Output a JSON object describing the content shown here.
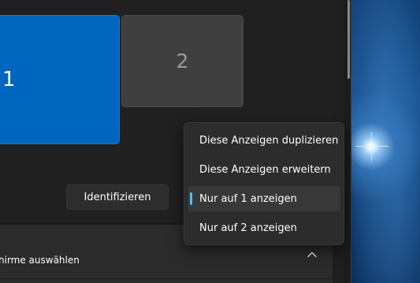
{
  "display_arrangement": {
    "monitors": [
      {
        "number": "1",
        "selected": true
      },
      {
        "number": "2",
        "selected": false
      }
    ],
    "identify_label": "Identifizieren"
  },
  "multi_display_menu": {
    "items": [
      {
        "label": "Diese Anzeigen duplizieren",
        "selected": false
      },
      {
        "label": "Diese Anzeigen erweitern",
        "selected": false
      },
      {
        "label": "Nur auf 1 anzeigen",
        "selected": true
      },
      {
        "label": "Nur auf 2 anzeigen",
        "selected": false
      }
    ],
    "accent_color": "#4cc2ff"
  },
  "setting_row": {
    "label": "hirme auswählen",
    "icon": "chevron-up-icon"
  },
  "colors": {
    "selected_monitor": "#0067c0",
    "unselected_monitor": "#3f3f3f",
    "background": "#1f1f1f"
  }
}
